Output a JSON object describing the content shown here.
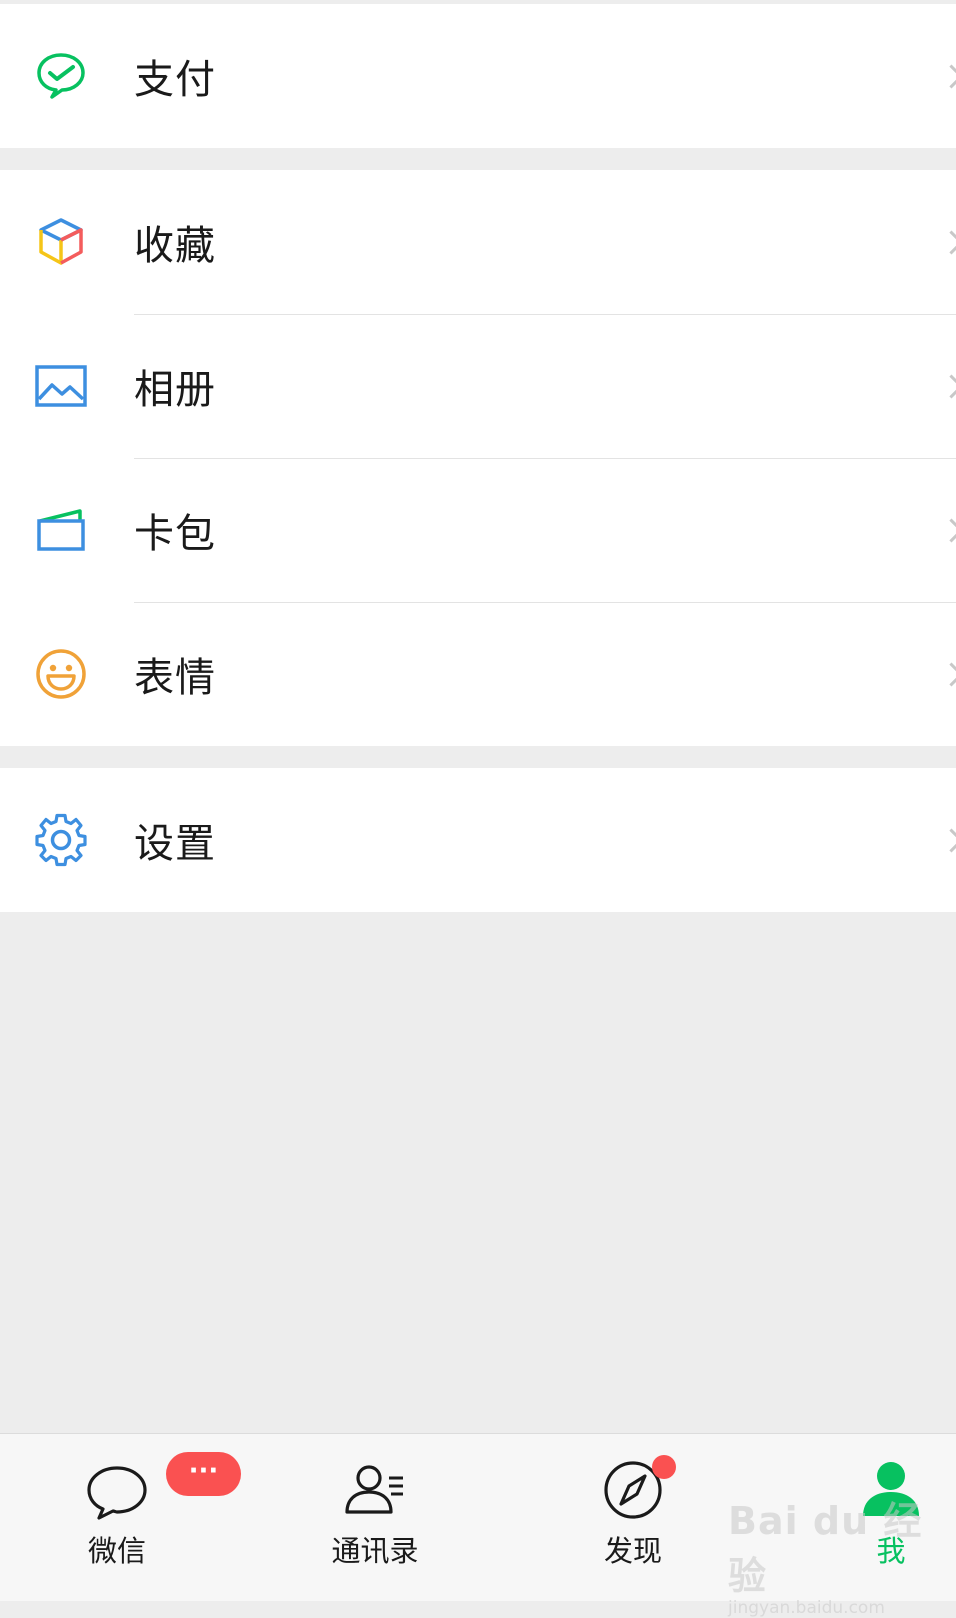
{
  "menu": {
    "pay": {
      "label": "支付",
      "icon": "wechat-pay-icon"
    },
    "favorites": {
      "label": "收藏",
      "icon": "cube-icon"
    },
    "album": {
      "label": "相册",
      "icon": "image-icon"
    },
    "cards": {
      "label": "卡包",
      "icon": "card-wallet-icon"
    },
    "stickers": {
      "label": "表情",
      "icon": "smiley-icon"
    },
    "settings": {
      "label": "设置",
      "icon": "gear-icon"
    }
  },
  "tabbar": {
    "chats": {
      "label": "微信",
      "icon": "chat-bubble-icon",
      "badge": "···"
    },
    "contacts": {
      "label": "通讯录",
      "icon": "contacts-icon"
    },
    "discover": {
      "label": "发现",
      "icon": "compass-icon"
    },
    "me": {
      "label": "我",
      "icon": "person-icon",
      "active": true
    }
  },
  "watermark": {
    "text": "Bai du 经验",
    "sub": "jingyan.baidu.com"
  },
  "colors": {
    "accent": "#07c160",
    "badge": "#fa5151",
    "background": "#ededed"
  }
}
